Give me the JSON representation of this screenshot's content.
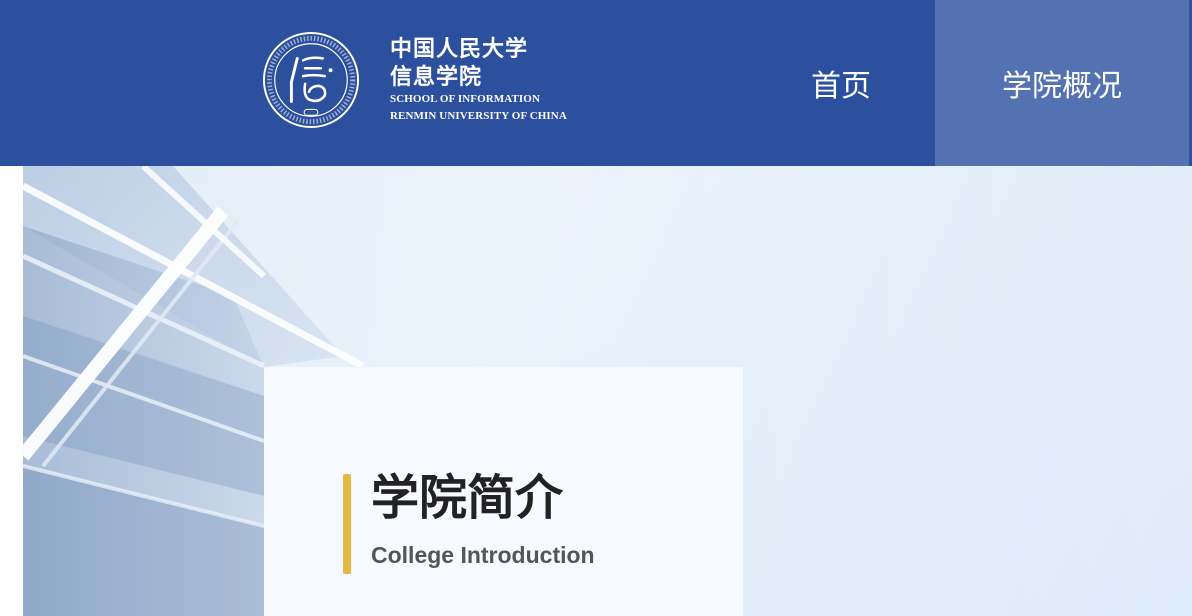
{
  "header": {
    "logo": {
      "icon": "school-seal-icon",
      "seal_text": "中国人民大学信息学院 SCHOOL OF INFORMATION RENMIN UNIVERSITY OF CHINA",
      "name_cn_line1": "中国人民大学",
      "name_cn_line2": "信息学院",
      "name_en_line1": "SCHOOL OF INFORMATION",
      "name_en_line2": "RENMIN UNIVERSITY OF CHINA"
    },
    "nav": [
      {
        "label": "首页",
        "active": false
      },
      {
        "label": "学院概况",
        "active": true
      }
    ]
  },
  "hero": {
    "background": "building-glass-facade-image"
  },
  "intro_card": {
    "title": "学院简介",
    "subtitle": "College Introduction",
    "accent_color": "#e6b944"
  },
  "colors": {
    "header_bg": "#2c4f9e",
    "nav_active_bg": "#5471b2",
    "accent": "#e6b944"
  }
}
